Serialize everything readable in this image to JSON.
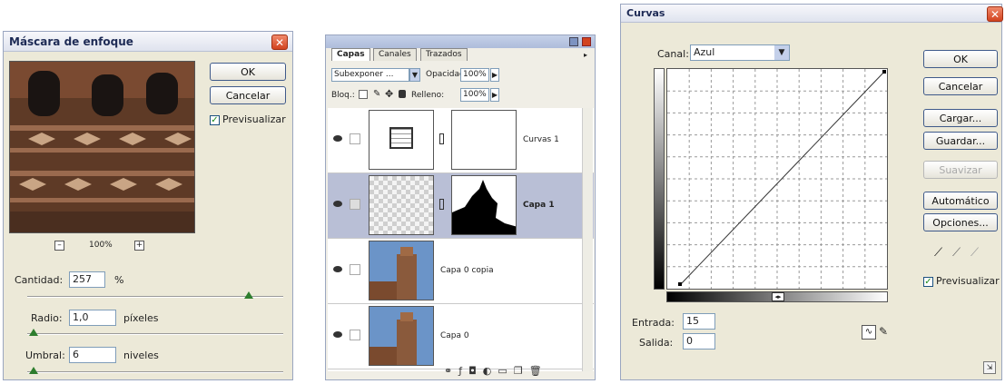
{
  "mask": {
    "title": "Máscara de enfoque",
    "close": "✕",
    "ok": "OK",
    "cancel": "Cancelar",
    "preview": "Previsualizar",
    "zoom": "100%",
    "zoom_out": "–",
    "zoom_in": "+",
    "amount_label": "Cantidad:",
    "amount_value": "257",
    "amount_unit": "%",
    "radius_label": "Radio:",
    "radius_value": "1,0",
    "radius_unit": "píxeles",
    "threshold_label": "Umbral:",
    "threshold_value": "6",
    "threshold_unit": "niveles"
  },
  "layers": {
    "tabs": [
      "Capas",
      "Canales",
      "Trazados"
    ],
    "blend_mode": "Subexponer ...",
    "opacity_label": "Opacidad:",
    "opacity_value": "100%",
    "lock_label": "Bloq.:",
    "fill_label": "Relleno:",
    "fill_value": "100%",
    "rows": [
      {
        "name": "Curvas 1"
      },
      {
        "name": "Capa 1"
      },
      {
        "name": "Capa 0 copia"
      },
      {
        "name": "Capa 0"
      }
    ]
  },
  "curves": {
    "title": "Curvas",
    "close": "✕",
    "channel_label": "Canal:",
    "channel_value": "Azul",
    "ok": "OK",
    "cancel": "Cancelar",
    "load": "Cargar...",
    "save": "Guardar...",
    "smooth": "Suavizar",
    "auto": "Automático",
    "options": "Opciones...",
    "preview": "Previsualizar",
    "input_label": "Entrada:",
    "input_value": "15",
    "output_label": "Salida:",
    "output_value": "0"
  },
  "colors": {
    "title_text": "#1d2a55",
    "close_red": "#d2431f",
    "dialog_bg": "#ece9d8",
    "selected_layer": "#b9bfd6"
  }
}
